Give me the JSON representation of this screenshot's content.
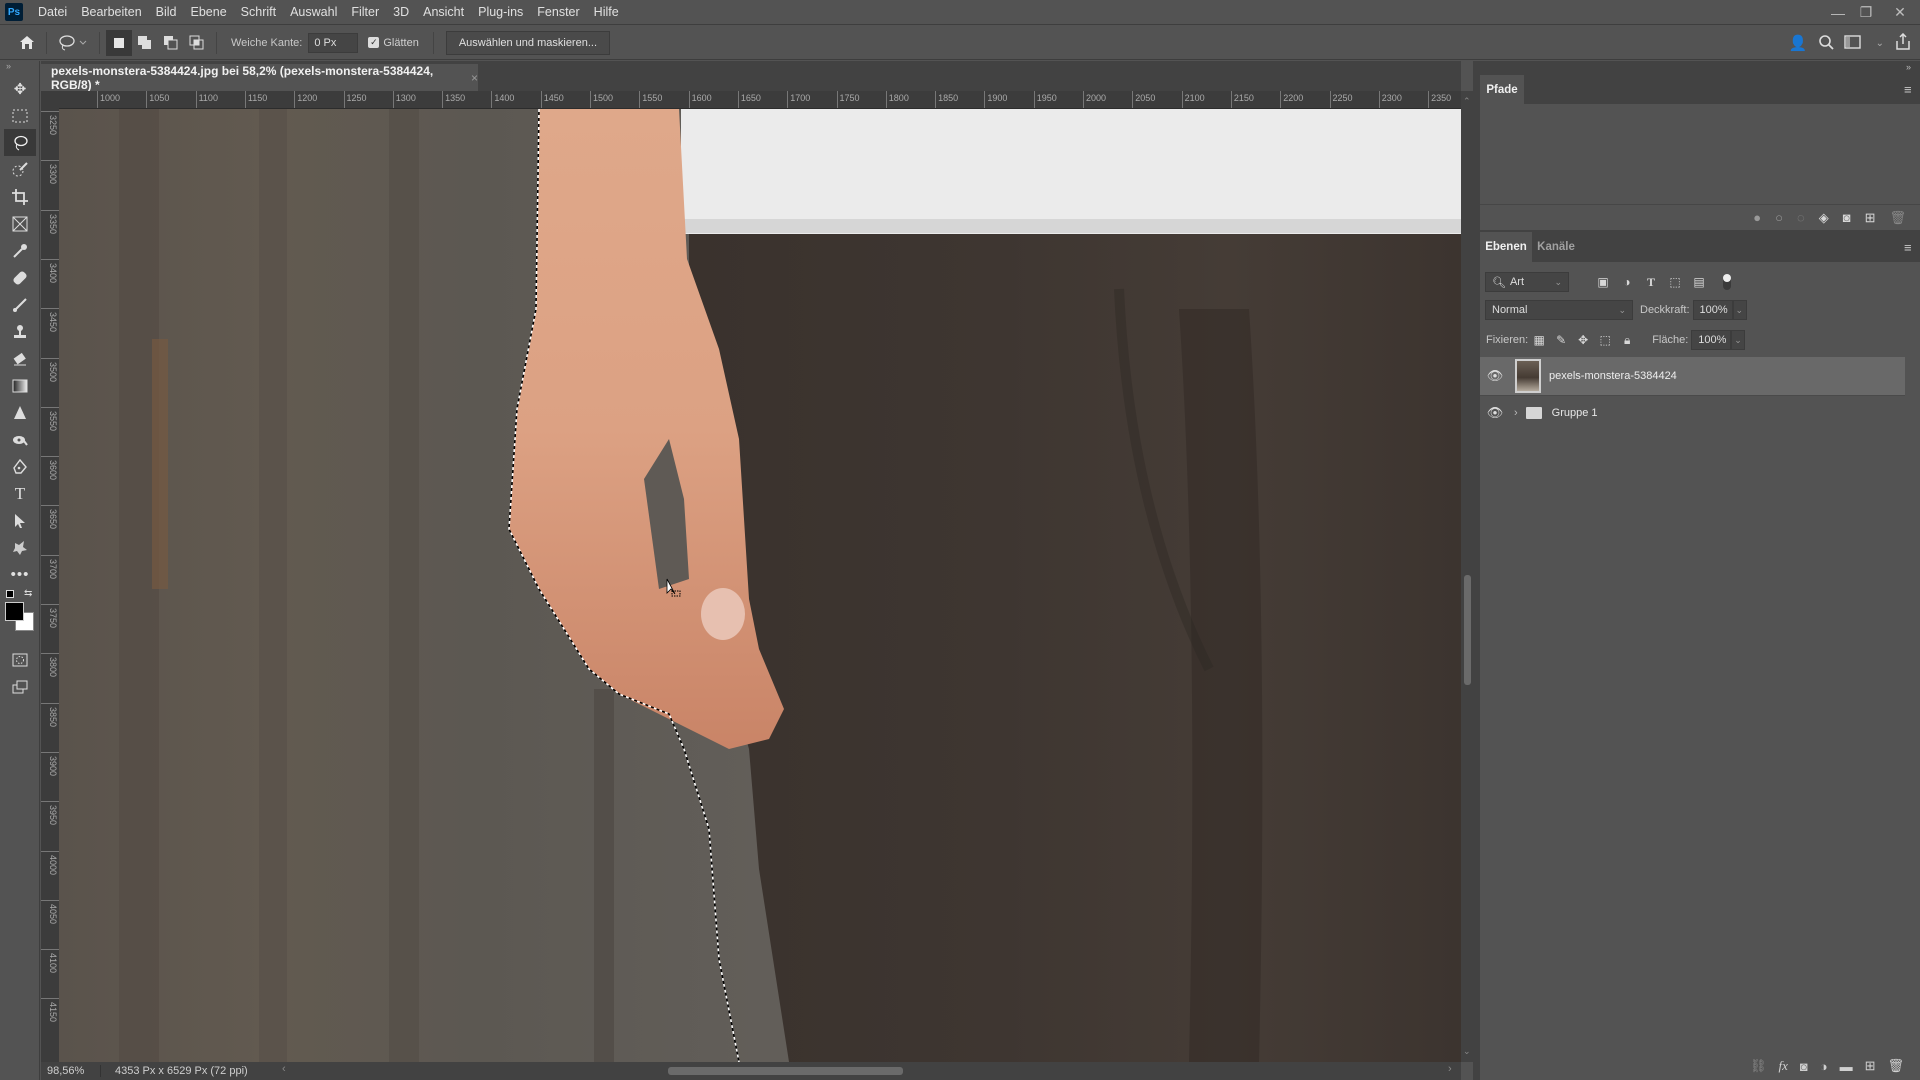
{
  "app": {
    "logo": "Ps"
  },
  "menu": [
    "Datei",
    "Bearbeiten",
    "Bild",
    "Ebene",
    "Schrift",
    "Auswahl",
    "Filter",
    "3D",
    "Ansicht",
    "Plug-ins",
    "Fenster",
    "Hilfe"
  ],
  "window_controls": {
    "minimize": "—",
    "restore": "❐",
    "close": "✕"
  },
  "options_bar": {
    "feather_label": "Weiche Kante:",
    "feather_value": "0 Px",
    "antialias_label": "Glätten",
    "antialias_checked": true,
    "select_mask_button": "Auswählen und maskieren..."
  },
  "document": {
    "tab_title": "pexels-monstera-5384424.jpg bei 58,2% (pexels-monstera-5384424, RGB/8) *",
    "close": "×"
  },
  "rulers": {
    "horizontal": [
      "1000",
      "1050",
      "1100",
      "1150",
      "1200",
      "1250",
      "1300",
      "1350",
      "1400",
      "1450",
      "1500",
      "1550",
      "1600",
      "1650",
      "1700",
      "1750",
      "1800",
      "1850",
      "1900",
      "1950",
      "2000",
      "2050",
      "2100",
      "2150",
      "2200",
      "2250",
      "2300",
      "2350"
    ],
    "vertical": [
      "3250",
      "3300",
      "3350",
      "3400",
      "3450",
      "3500",
      "3550",
      "3600",
      "3650",
      "3700",
      "3750",
      "3800",
      "3850",
      "3900",
      "3950",
      "4000",
      "4050",
      "4100",
      "4150"
    ]
  },
  "status": {
    "zoom": "98,56%",
    "doc_info": "4353 Px x 6529 Px (72 ppi)"
  },
  "paths_panel": {
    "tab": "Pfade"
  },
  "layers_panel": {
    "tabs": [
      "Ebenen",
      "Kanäle"
    ],
    "active_tab": "Ebenen",
    "filter_label": "Art",
    "blend_mode": "Normal",
    "opacity_label": "Deckkraft:",
    "opacity_value": "100%",
    "lock_label": "Fixieren:",
    "fill_label": "Fläche:",
    "fill_value": "100%",
    "layers": [
      {
        "name": "pexels-monstera-5384424",
        "type": "pixel",
        "visible": true,
        "selected": true
      },
      {
        "name": "Gruppe 1",
        "type": "group",
        "visible": true,
        "selected": false
      }
    ]
  }
}
